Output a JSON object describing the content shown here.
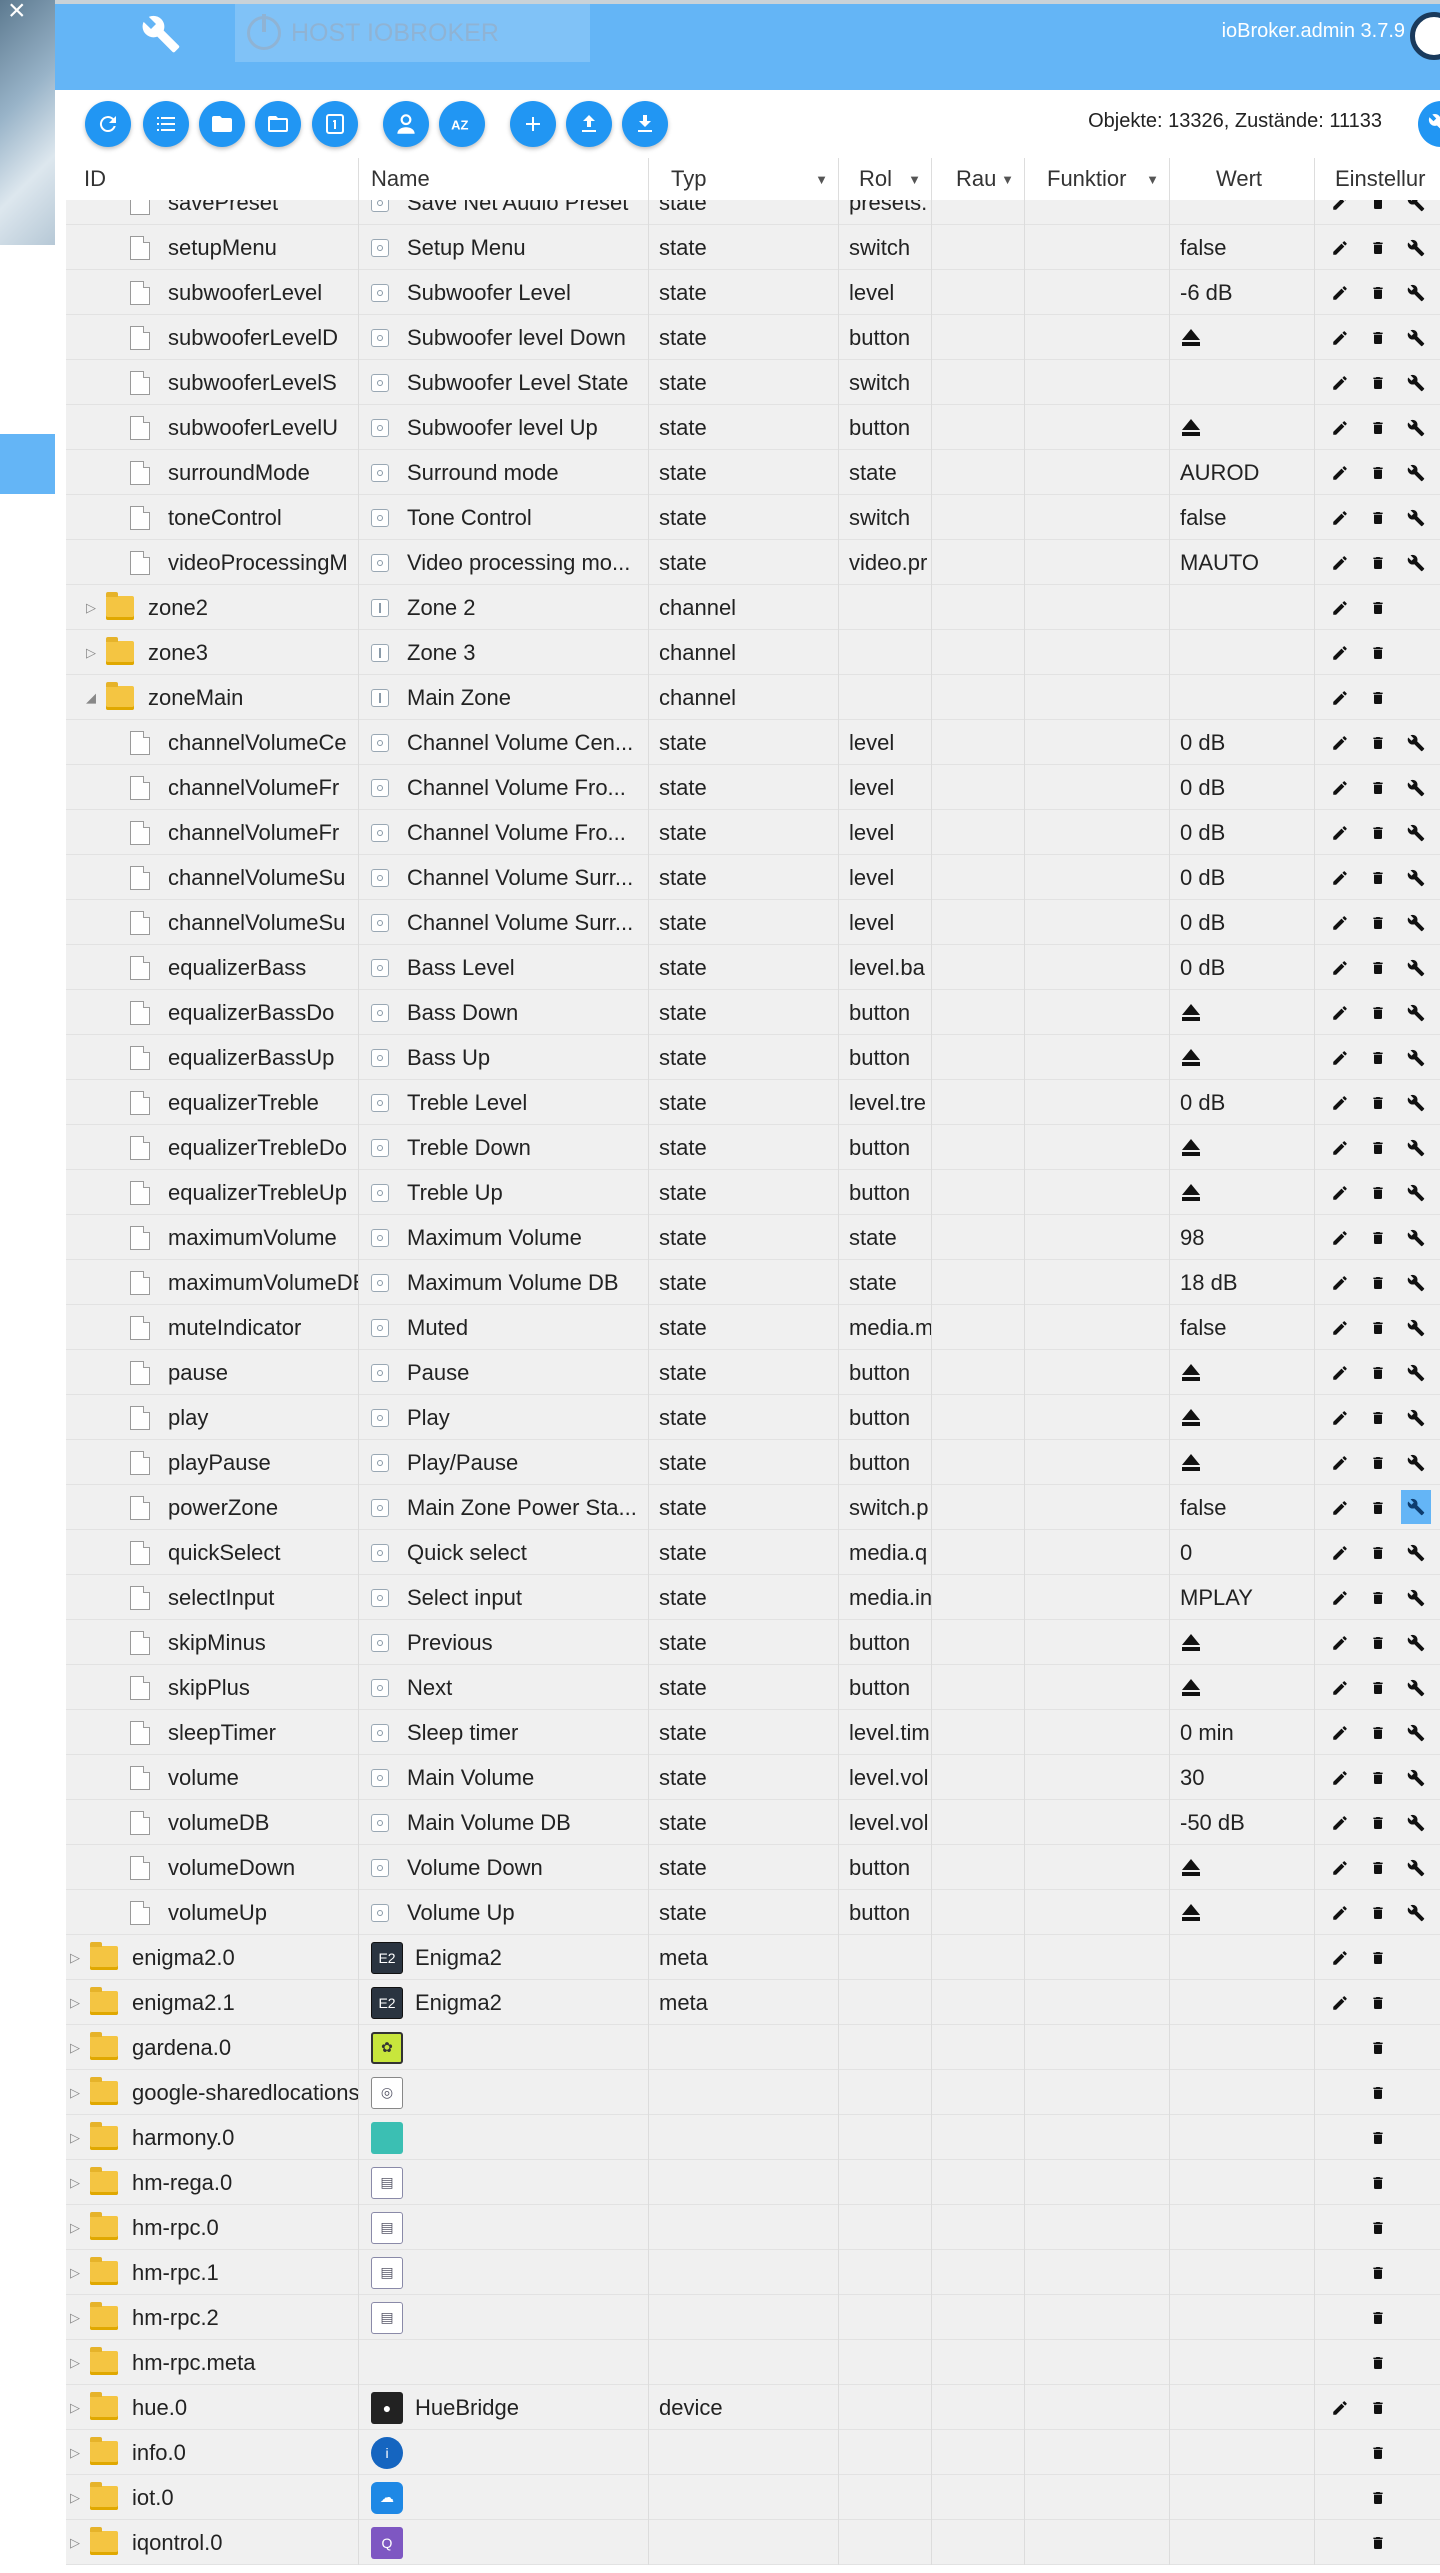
{
  "app": {
    "host_label": "HOST IOBROKER",
    "version": "ioBroker.admin 3.7.9",
    "counts": "Objekte: 13326, Zustände: 11133"
  },
  "toolbar_icons": [
    "refresh-icon",
    "list-icon",
    "folder-icon",
    "folder-open-icon",
    "number-one-icon",
    "expert-mode-icon",
    "sort-az-icon",
    "add-icon",
    "upload-icon",
    "download-icon"
  ],
  "columns": {
    "id": "ID",
    "name": "Name",
    "typ": "Typ",
    "rol": "Rol",
    "raum": "Rau",
    "funktion": "Funktior",
    "wert": "Wert",
    "einstellungen": "Einstellur"
  },
  "rows": [
    {
      "id": "savePreset",
      "name": "Save Net Audio Preset",
      "typ": "state",
      "rol": "presets.",
      "wert": "",
      "kind": "state",
      "level": 2,
      "actions": "ewr"
    },
    {
      "id": "setupMenu",
      "name": "Setup Menu",
      "typ": "state",
      "rol": "switch",
      "wert": "false",
      "kind": "state",
      "level": 2,
      "actions": "ewr"
    },
    {
      "id": "subwooferLevel",
      "name": "Subwoofer Level",
      "typ": "state",
      "rol": "level",
      "wert": "-6 dB",
      "kind": "state",
      "level": 2,
      "actions": "ewr"
    },
    {
      "id": "subwooferLevelD",
      "name": "Subwoofer level Down",
      "typ": "state",
      "rol": "button",
      "wert": "",
      "eject": true,
      "kind": "state",
      "level": 2,
      "actions": "ewr"
    },
    {
      "id": "subwooferLevelS",
      "name": "Subwoofer Level State",
      "typ": "state",
      "rol": "switch",
      "wert": "",
      "kind": "state",
      "level": 2,
      "actions": "ewr"
    },
    {
      "id": "subwooferLevelU",
      "name": "Subwoofer level Up",
      "typ": "state",
      "rol": "button",
      "wert": "",
      "eject": true,
      "kind": "state",
      "level": 2,
      "actions": "ewr"
    },
    {
      "id": "surroundMode",
      "name": "Surround mode",
      "typ": "state",
      "rol": "state",
      "wert": "AUROD",
      "kind": "state",
      "level": 2,
      "actions": "ewr"
    },
    {
      "id": "toneControl",
      "name": "Tone Control",
      "typ": "state",
      "rol": "switch",
      "wert": "false",
      "kind": "state",
      "level": 2,
      "actions": "ewr"
    },
    {
      "id": "videoProcessingM",
      "name": "Video processing mo...",
      "typ": "state",
      "rol": "video.pr",
      "wert": "MAUTO",
      "kind": "state",
      "level": 2,
      "actions": "ewr"
    },
    {
      "id": "zone2",
      "name": "Zone 2",
      "typ": "channel",
      "rol": "",
      "wert": "",
      "kind": "channel",
      "level": 1,
      "expand": "closed",
      "actions": "ed"
    },
    {
      "id": "zone3",
      "name": "Zone 3",
      "typ": "channel",
      "rol": "",
      "wert": "",
      "kind": "channel",
      "level": 1,
      "expand": "closed",
      "actions": "ed"
    },
    {
      "id": "zoneMain",
      "name": "Main Zone",
      "typ": "channel",
      "rol": "",
      "wert": "",
      "kind": "channel",
      "level": 1,
      "expand": "open",
      "actions": "ed"
    },
    {
      "id": "channelVolumeCe",
      "name": "Channel Volume Cen...",
      "typ": "state",
      "rol": "level",
      "wert": "0 dB",
      "kind": "state",
      "level": 2,
      "actions": "ewr"
    },
    {
      "id": "channelVolumeFr",
      "name": "Channel Volume Fro...",
      "typ": "state",
      "rol": "level",
      "wert": "0 dB",
      "kind": "state",
      "level": 2,
      "actions": "ewr"
    },
    {
      "id": "channelVolumeFr",
      "name": "Channel Volume Fro...",
      "typ": "state",
      "rol": "level",
      "wert": "0 dB",
      "kind": "state",
      "level": 2,
      "actions": "ewr"
    },
    {
      "id": "channelVolumeSu",
      "name": "Channel Volume Surr...",
      "typ": "state",
      "rol": "level",
      "wert": "0 dB",
      "kind": "state",
      "level": 2,
      "actions": "ewr"
    },
    {
      "id": "channelVolumeSu",
      "name": "Channel Volume Surr...",
      "typ": "state",
      "rol": "level",
      "wert": "0 dB",
      "kind": "state",
      "level": 2,
      "actions": "ewr"
    },
    {
      "id": "equalizerBass",
      "name": "Bass Level",
      "typ": "state",
      "rol": "level.ba",
      "wert": "0 dB",
      "kind": "state",
      "level": 2,
      "actions": "ewr"
    },
    {
      "id": "equalizerBassDo",
      "name": "Bass Down",
      "typ": "state",
      "rol": "button",
      "wert": "",
      "eject": true,
      "kind": "state",
      "level": 2,
      "actions": "ewr"
    },
    {
      "id": "equalizerBassUp",
      "name": "Bass Up",
      "typ": "state",
      "rol": "button",
      "wert": "",
      "eject": true,
      "kind": "state",
      "level": 2,
      "actions": "ewr"
    },
    {
      "id": "equalizerTreble",
      "name": "Treble Level",
      "typ": "state",
      "rol": "level.tre",
      "wert": "0 dB",
      "kind": "state",
      "level": 2,
      "actions": "ewr"
    },
    {
      "id": "equalizerTrebleDo",
      "name": "Treble Down",
      "typ": "state",
      "rol": "button",
      "wert": "",
      "eject": true,
      "kind": "state",
      "level": 2,
      "actions": "ewr"
    },
    {
      "id": "equalizerTrebleUp",
      "name": "Treble Up",
      "typ": "state",
      "rol": "button",
      "wert": "",
      "eject": true,
      "kind": "state",
      "level": 2,
      "actions": "ewr"
    },
    {
      "id": "maximumVolume",
      "name": "Maximum Volume",
      "typ": "state",
      "rol": "state",
      "wert": "98",
      "kind": "state",
      "level": 2,
      "actions": "ewr"
    },
    {
      "id": "maximumVolumeDB",
      "name": "Maximum Volume DB",
      "typ": "state",
      "rol": "state",
      "wert": "18 dB",
      "kind": "state",
      "level": 2,
      "actions": "ewr"
    },
    {
      "id": "muteIndicator",
      "name": "Muted",
      "typ": "state",
      "rol": "media.m",
      "wert": "false",
      "kind": "state",
      "level": 2,
      "actions": "ewr"
    },
    {
      "id": "pause",
      "name": "Pause",
      "typ": "state",
      "rol": "button",
      "wert": "",
      "eject": true,
      "kind": "state",
      "level": 2,
      "actions": "ewr"
    },
    {
      "id": "play",
      "name": "Play",
      "typ": "state",
      "rol": "button",
      "wert": "",
      "eject": true,
      "kind": "state",
      "level": 2,
      "actions": "ewr"
    },
    {
      "id": "playPause",
      "name": "Play/Pause",
      "typ": "state",
      "rol": "button",
      "wert": "",
      "eject": true,
      "kind": "state",
      "level": 2,
      "actions": "ewr"
    },
    {
      "id": "powerZone",
      "name": "Main Zone Power Sta...",
      "typ": "state",
      "rol": "switch.p",
      "wert": "false",
      "kind": "state",
      "level": 2,
      "actions": "ewr",
      "highlight": true
    },
    {
      "id": "quickSelect",
      "name": "Quick select",
      "typ": "state",
      "rol": "media.q",
      "wert": "0",
      "kind": "state",
      "level": 2,
      "actions": "ewr"
    },
    {
      "id": "selectInput",
      "name": "Select input",
      "typ": "state",
      "rol": "media.in",
      "wert": "MPLAY",
      "kind": "state",
      "level": 2,
      "actions": "ewr"
    },
    {
      "id": "skipMinus",
      "name": "Previous",
      "typ": "state",
      "rol": "button",
      "wert": "",
      "eject": true,
      "kind": "state",
      "level": 2,
      "actions": "ewr"
    },
    {
      "id": "skipPlus",
      "name": "Next",
      "typ": "state",
      "rol": "button",
      "wert": "",
      "eject": true,
      "kind": "state",
      "level": 2,
      "actions": "ewr"
    },
    {
      "id": "sleepTimer",
      "name": "Sleep timer",
      "typ": "state",
      "rol": "level.tim",
      "wert": "0 min",
      "kind": "state",
      "level": 2,
      "actions": "ewr"
    },
    {
      "id": "volume",
      "name": "Main Volume",
      "typ": "state",
      "rol": "level.vol",
      "wert": "30",
      "kind": "state",
      "level": 2,
      "actions": "ewr"
    },
    {
      "id": "volumeDB",
      "name": "Main Volume DB",
      "typ": "state",
      "rol": "level.vol",
      "wert": "-50 dB",
      "kind": "state",
      "level": 2,
      "actions": "ewr"
    },
    {
      "id": "volumeDown",
      "name": "Volume Down",
      "typ": "state",
      "rol": "button",
      "wert": "",
      "eject": true,
      "kind": "state",
      "level": 2,
      "actions": "ewr"
    },
    {
      "id": "volumeUp",
      "name": "Volume Up",
      "typ": "state",
      "rol": "button",
      "wert": "",
      "eject": true,
      "kind": "state",
      "level": 2,
      "actions": "ewr"
    },
    {
      "id": "enigma2.0",
      "name": "Enigma2",
      "typ": "meta",
      "rol": "",
      "wert": "",
      "kind": "adapter",
      "adapter_icon": "enigma2-icon",
      "level": 0,
      "expand": "closed",
      "actions": "ed"
    },
    {
      "id": "enigma2.1",
      "name": "Enigma2",
      "typ": "meta",
      "rol": "",
      "wert": "",
      "kind": "adapter",
      "adapter_icon": "enigma2-icon",
      "level": 0,
      "expand": "closed",
      "actions": "ed"
    },
    {
      "id": "gardena.0",
      "name": "",
      "typ": "",
      "rol": "",
      "wert": "",
      "kind": "adapter",
      "adapter_icon": "gardena-icon",
      "level": 0,
      "expand": "closed",
      "actions": "d"
    },
    {
      "id": "google-sharedlocations.0",
      "name": "",
      "typ": "",
      "rol": "",
      "wert": "",
      "kind": "adapter",
      "adapter_icon": "google-sharedlocations-icon",
      "level": 0,
      "expand": "closed",
      "actions": "d"
    },
    {
      "id": "harmony.0",
      "name": "",
      "typ": "",
      "rol": "",
      "wert": "",
      "kind": "adapter",
      "adapter_icon": "harmony-icon",
      "level": 0,
      "expand": "closed",
      "actions": "d"
    },
    {
      "id": "hm-rega.0",
      "name": "",
      "typ": "",
      "rol": "",
      "wert": "",
      "kind": "adapter",
      "adapter_icon": "homematic-icon",
      "level": 0,
      "expand": "closed",
      "actions": "d"
    },
    {
      "id": "hm-rpc.0",
      "name": "",
      "typ": "",
      "rol": "",
      "wert": "",
      "kind": "adapter",
      "adapter_icon": "homematic-icon",
      "level": 0,
      "expand": "closed",
      "actions": "d"
    },
    {
      "id": "hm-rpc.1",
      "name": "",
      "typ": "",
      "rol": "",
      "wert": "",
      "kind": "adapter",
      "adapter_icon": "homematic-icon",
      "level": 0,
      "expand": "closed",
      "actions": "d"
    },
    {
      "id": "hm-rpc.2",
      "name": "",
      "typ": "",
      "rol": "",
      "wert": "",
      "kind": "adapter",
      "adapter_icon": "homematic-icon",
      "level": 0,
      "expand": "closed",
      "actions": "d"
    },
    {
      "id": "hm-rpc.meta",
      "name": "",
      "typ": "",
      "rol": "",
      "wert": "",
      "kind": "adapter",
      "adapter_icon": "",
      "level": 0,
      "expand": "closed",
      "actions": "d"
    },
    {
      "id": "hue.0",
      "name": "HueBridge",
      "typ": "device",
      "rol": "",
      "wert": "",
      "kind": "adapter",
      "adapter_icon": "hue-bridge-icon",
      "level": 0,
      "expand": "closed",
      "actions": "ed"
    },
    {
      "id": "info.0",
      "name": "",
      "typ": "",
      "rol": "",
      "wert": "",
      "kind": "adapter",
      "adapter_icon": "info-icon",
      "level": 0,
      "expand": "closed",
      "actions": "d"
    },
    {
      "id": "iot.0",
      "name": "",
      "typ": "",
      "rol": "",
      "wert": "",
      "kind": "adapter",
      "adapter_icon": "cloud-icon",
      "level": 0,
      "expand": "closed",
      "actions": "d"
    },
    {
      "id": "iqontrol.0",
      "name": "",
      "typ": "",
      "rol": "",
      "wert": "",
      "kind": "adapter",
      "adapter_icon": "iqontrol-icon",
      "level": 0,
      "expand": "closed",
      "actions": "d"
    }
  ],
  "colors": {
    "header_blue": "#64b5f6",
    "button_blue": "#2196f3",
    "row_gray": "#f0f0f0"
  }
}
